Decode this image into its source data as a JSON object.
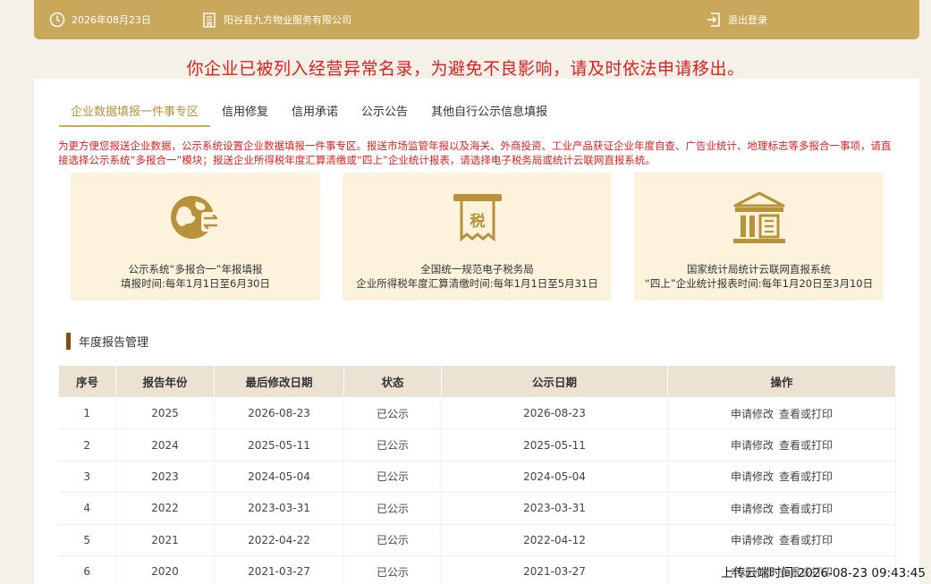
{
  "header": {
    "date": "2026年08月23日",
    "company": "阳谷县九方物业服务有限公司",
    "logout_label": "退出登录"
  },
  "notice": "你企业已被列入经营异常名录，为避免不良影响，请及时依法申请移出。",
  "tabs": [
    {
      "label": "企业数据填报一件事专区",
      "active": true
    },
    {
      "label": "信用修复"
    },
    {
      "label": "信用承诺"
    },
    {
      "label": "公示公告"
    },
    {
      "label": "其他自行公示信息填报"
    }
  ],
  "intro_text": "为更方便您报送企业数据，公示系统设置企业数据填报一件事专区。报送市场监管年报以及海关、外商投资、工业产品获证企业年度自查、广告业统计、地理标志等多报合一事项，请直接选择公示系统“多报合一”模块；报送企业所得税年度汇算清缴或“四上”企业统计报表，请选择电子税务局或统计云联网直报系统。",
  "tiles": [
    {
      "icon": "globe-exchange-icon",
      "line1": "公示系统“多报合一”年报填报",
      "line2": "填报时间:每年1月1日至6月30日"
    },
    {
      "icon": "tax-ticket-icon",
      "icon_text": "税",
      "line1": "全国统一规范电子税务局",
      "line2": "企业所得税年度汇算清缴时间:每年1月1日至5月31日"
    },
    {
      "icon": "government-building-icon",
      "line1": "国家统计局统计云联网直报系统",
      "line2": "“四上”企业统计报表时间:每年1月20日至3月10日"
    }
  ],
  "section_title": "年度报告管理",
  "table": {
    "headers": [
      "序号",
      "报告年份",
      "最后修改日期",
      "状态",
      "公示日期",
      "操作"
    ],
    "rows": [
      {
        "no": "1",
        "year": "2025",
        "modified": "2026-08-23",
        "status": "已公示",
        "published": "2026-08-23"
      },
      {
        "no": "2",
        "year": "2024",
        "modified": "2025-05-11",
        "status": "已公示",
        "published": "2025-05-11"
      },
      {
        "no": "3",
        "year": "2023",
        "modified": "2024-05-04",
        "status": "已公示",
        "published": "2024-05-04"
      },
      {
        "no": "4",
        "year": "2022",
        "modified": "2023-03-31",
        "status": "已公示",
        "published": "2023-03-31"
      },
      {
        "no": "5",
        "year": "2021",
        "modified": "2022-04-22",
        "status": "已公示",
        "published": "2022-04-12"
      },
      {
        "no": "6",
        "year": "2020",
        "modified": "2021-03-27",
        "status": "已公示",
        "published": "2021-03-27"
      }
    ],
    "action_modify": "申请修改",
    "action_view": "查看或打印"
  },
  "upload_timestamp": "上传云端时间:2026-08-23 09:43:45",
  "colors": {
    "gold": "#c9a75b",
    "alert": "#e02020",
    "tile_bg": "#fdf2dc"
  }
}
